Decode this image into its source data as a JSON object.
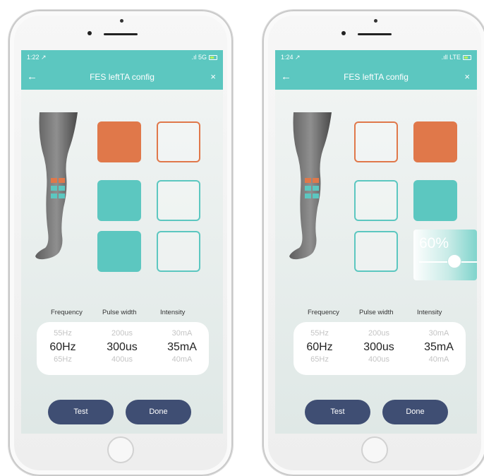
{
  "phones": [
    {
      "status": {
        "time": "1:22 ↗",
        "signal": ".ıl 5G"
      },
      "nav": {
        "back": "←",
        "title": "FES leftTA config",
        "close": "×"
      },
      "pads": [
        {
          "row": 1,
          "col": 1,
          "color": "orange",
          "state": "filled"
        },
        {
          "row": 1,
          "col": 2,
          "color": "orange",
          "state": "outline"
        },
        {
          "row": 2,
          "col": 1,
          "color": "teal",
          "state": "filled"
        },
        {
          "row": 2,
          "col": 2,
          "color": "teal",
          "state": "outline"
        },
        {
          "row": 3,
          "col": 1,
          "color": "teal",
          "state": "filled"
        },
        {
          "row": 3,
          "col": 2,
          "color": "teal",
          "state": "outline"
        }
      ],
      "headers": {
        "frequency": "Frequency",
        "pulse_width": "Pulse width",
        "intensity": "Intensity"
      },
      "frequency": {
        "above": "55Hz",
        "selected": "60Hz",
        "below": "65Hz"
      },
      "pulse_width": {
        "above": "200us",
        "selected": "300us",
        "below": "400us"
      },
      "intensity": {
        "above": "30mA",
        "selected": "35mA",
        "below": "40mA"
      },
      "buttons": {
        "test": "Test",
        "done": "Done"
      }
    },
    {
      "status": {
        "time": "1:24 ↗",
        "signal": ".ıll LTE"
      },
      "nav": {
        "back": "←",
        "title": "FES leftTA config",
        "close": "×"
      },
      "pads": [
        {
          "row": 1,
          "col": 1,
          "color": "orange",
          "state": "outline"
        },
        {
          "row": 1,
          "col": 2,
          "color": "orange",
          "state": "filled"
        },
        {
          "row": 2,
          "col": 1,
          "color": "teal",
          "state": "outline"
        },
        {
          "row": 2,
          "col": 2,
          "color": "teal",
          "state": "filled"
        },
        {
          "row": 3,
          "col": 1,
          "color": "teal",
          "state": "outline"
        }
      ],
      "slider": {
        "value_label": "60%",
        "level": 0.6
      },
      "headers": {
        "frequency": "Frequency",
        "pulse_width": "Pulse width",
        "intensity": "Intensity"
      },
      "frequency": {
        "above": "55Hz",
        "selected": "60Hz",
        "below": "65Hz"
      },
      "pulse_width": {
        "above": "200us",
        "selected": "300us",
        "below": "400us"
      },
      "intensity": {
        "above": "30mA",
        "selected": "35mA",
        "below": "40mA"
      },
      "buttons": {
        "test": "Test",
        "done": "Done"
      }
    }
  ],
  "colors": {
    "accent_teal": "#5cc7c0",
    "accent_orange": "#e0784a",
    "button_navy": "#3f4e73"
  },
  "icons": {
    "back": "arrow-left-icon",
    "close": "close-icon",
    "battery": "battery-icon"
  }
}
